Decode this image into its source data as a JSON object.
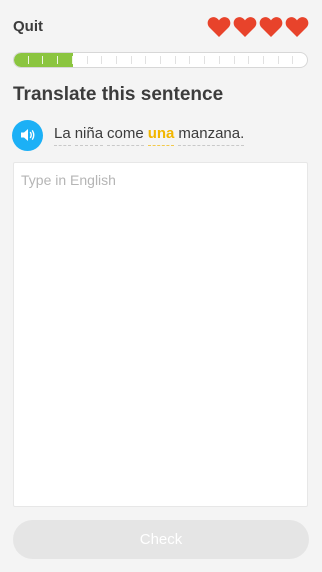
{
  "header": {
    "quit_label": "Quit",
    "hearts_count": 4,
    "heart_color": "#e8432b"
  },
  "progress": {
    "completed_segments": 4,
    "total_segments": 20,
    "fill_color": "#8bc53f"
  },
  "exercise": {
    "title": "Translate this sentence",
    "speaker_icon": "speaker-icon",
    "sentence_words": [
      {
        "text": "La",
        "new": false
      },
      {
        "text": "niña",
        "new": false
      },
      {
        "text": "come",
        "new": false
      },
      {
        "text": "una",
        "new": true
      },
      {
        "text": "manzana.",
        "new": false
      }
    ]
  },
  "answer": {
    "placeholder": "Type in English",
    "value": ""
  },
  "footer": {
    "check_label": "Check"
  },
  "colors": {
    "accent_blue": "#1cb0f6",
    "new_word": "#f2b600",
    "disabled_button": "#e5e5e5"
  }
}
